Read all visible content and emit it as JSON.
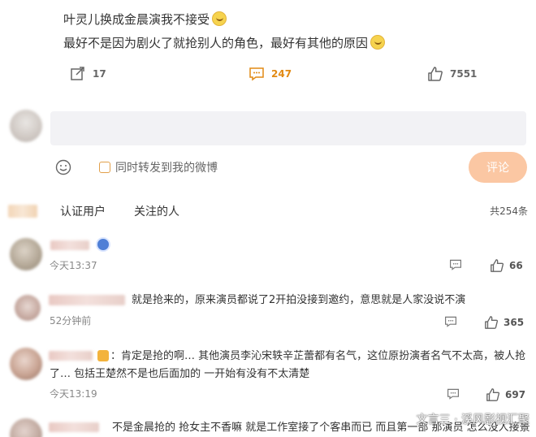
{
  "post": {
    "line1": "叶灵儿换成金晨演我不接受",
    "line2": "最好不是因为剧火了就抢别人的角色，最好有其他的原因"
  },
  "actions": {
    "repost_count": "17",
    "comment_count": "247",
    "like_count": "7551"
  },
  "composer": {
    "repost_label": "同时转发到我的微博",
    "submit_label": "评论"
  },
  "tabs": {
    "verified": "认证用户",
    "following": "关注的人",
    "total": "共254条"
  },
  "comments": [
    {
      "text": "",
      "time": "今天13:37",
      "likes": "66"
    },
    {
      "text": "就是抢来的，原来演员都说了2开拍没接到邀约，意思就是人家没说不演",
      "time": "52分钟前",
      "likes": "365"
    },
    {
      "text_line1": "：肯定是抢的啊… 其他演员李沁宋轶辛芷蕾都有名气，这位原扮演者名气不太高，被人抢",
      "text_line2": "了… 包括王楚然不是也后面加的 一开始有没有不太清楚",
      "time": "今天13:19",
      "likes": "697"
    },
    {
      "text": "不是金晨抢的 抢女主不香嘛 就是工作室接了个客串而已 而且第一部 那演员 怎么没人接景"
    }
  ],
  "watermark": "文言三 · 溪风影视汇聚"
}
